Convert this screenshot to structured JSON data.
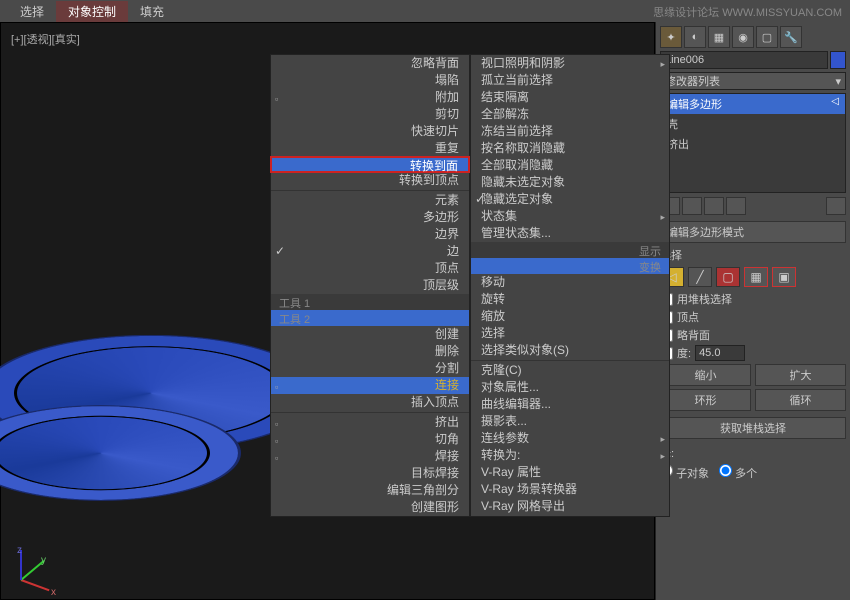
{
  "watermark": "思缘设计论坛  WWW.MISSYUAN.COM",
  "url": "",
  "top_menu": {
    "tab1": "选择",
    "tab2": "对象控制",
    "tab3": "填充"
  },
  "viewport": {
    "label": "[+][透视][真实]"
  },
  "axis": {
    "x": "x",
    "y": "y",
    "z": "z"
  },
  "context_menu": {
    "col1": {
      "items": [
        "忽略背面",
        "塌陷",
        "附加",
        "剪切",
        "快速切片",
        "重复",
        "转换到面",
        "转换到顶点",
        "元素",
        "多边形",
        "边界",
        "边",
        "顶点",
        "顶层级"
      ],
      "tools1": "工具 1",
      "tools2": "工具 2",
      "items2": [
        "创建",
        "删除",
        "分割",
        "连接",
        "插入顶点",
        "挤出",
        "切角",
        "焊接",
        "目标焊接",
        "编辑三角剖分",
        "创建图形"
      ],
      "show": "显示",
      "transform": "变换"
    },
    "col2": {
      "items": [
        "视口照明和阴影",
        "孤立当前选择",
        "结束隔离",
        "全部解冻",
        "冻结当前选择",
        "按名称取消隐藏",
        "全部取消隐藏",
        "隐藏未选定对象",
        "隐藏选定对象",
        "状态集",
        "管理状态集..."
      ],
      "items2": [
        "移动",
        "旋转",
        "缩放",
        "选择",
        "选择类似对象(S)",
        "克隆(C)",
        "对象属性...",
        "曲线编辑器...",
        "摄影表...",
        "连线参数",
        "转换为:",
        "V-Ray 属性",
        "V-Ray 场景转换器",
        "V-Ray 网格导出"
      ]
    }
  },
  "right_panel": {
    "object_name": "Line006",
    "mod_label": "修改器列表",
    "mod_stack": {
      "item1": "编辑多边形",
      "item2": "壳",
      "item3": "挤出"
    },
    "rollout": "编辑多边形模式",
    "selection": "选择",
    "stack_select": "用堆栈选择",
    "vertex": "顶点",
    "backface": "略背面",
    "angle": "度:",
    "angle_val": "45.0",
    "shrink": "缩小",
    "grow": "扩大",
    "ring": "环形",
    "loop": "循环",
    "get_stack": "获取堆栈选择",
    "select_lbl": "择:",
    "sub_obj": "子对象",
    "multi": "多个"
  }
}
